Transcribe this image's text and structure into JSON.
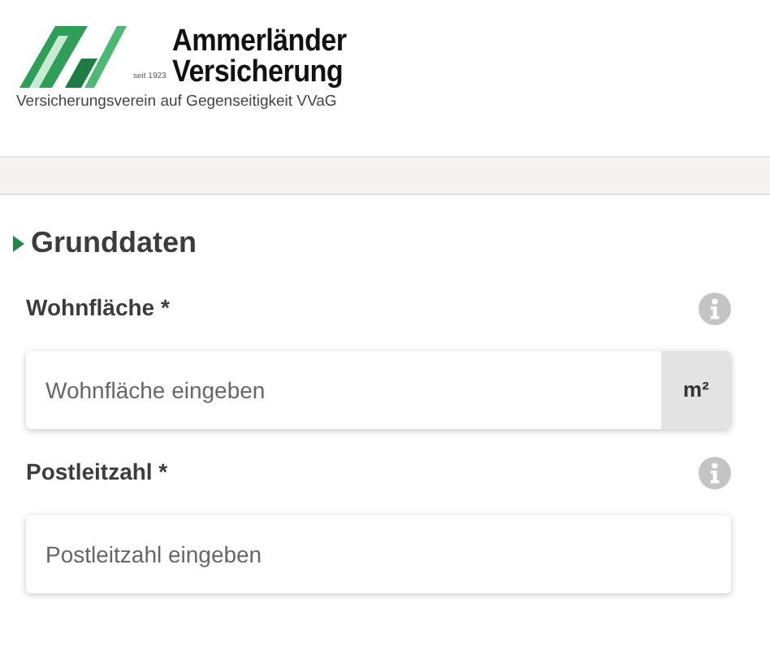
{
  "logo": {
    "name_lines": [
      "Ammerländer",
      "Versicherung"
    ],
    "since": "seit 1923",
    "tagline": "Versicherungsverein auf Gegenseitigkeit VVaG"
  },
  "section": {
    "title": "Grunddaten"
  },
  "fields": [
    {
      "label": "Wohnfläche *",
      "placeholder": "Wohnfläche eingeben",
      "unit": "m²"
    },
    {
      "label": "Postleitzahl *",
      "placeholder": "Postleitzahl eingeben"
    }
  ]
}
